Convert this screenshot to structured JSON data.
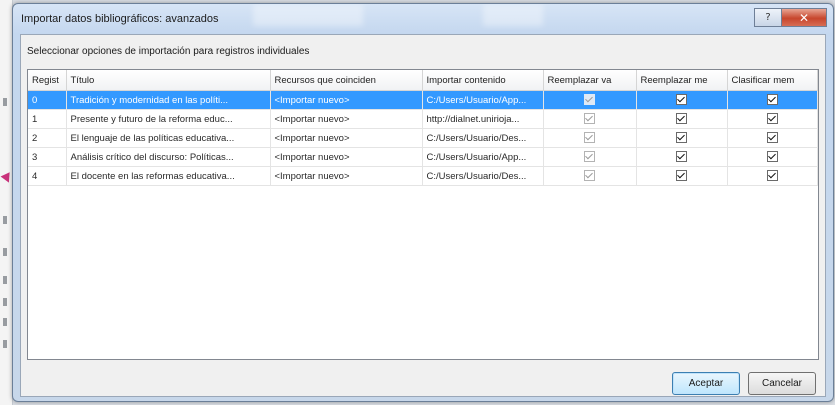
{
  "window": {
    "title": "Importar datos bibliográficos: avanzados"
  },
  "section_label": "Seleccionar opciones de importación para registros individuales",
  "table": {
    "columns": [
      "Regist",
      "Título",
      "Recursos que coinciden",
      "Importar contenido",
      "Reemplazar va",
      "Reemplazar me",
      "Clasificar mem"
    ],
    "rows": [
      {
        "regist": "0",
        "titulo": "Tradición y modernidad en las políti...",
        "recursos": "<Importar nuevo>",
        "importar": "C:/Users/Usuario/App...",
        "reemplazar_va": true,
        "reemplazar_me": true,
        "clasificar": true,
        "selected": true
      },
      {
        "regist": "1",
        "titulo": "Presente y futuro de la reforma educ...",
        "recursos": "<Importar nuevo>",
        "importar": "http://dialnet.unirioja...",
        "reemplazar_va": true,
        "reemplazar_me": true,
        "clasificar": true,
        "selected": false
      },
      {
        "regist": "2",
        "titulo": "El lenguaje de las políticas educativa...",
        "recursos": "<Importar nuevo>",
        "importar": "C:/Users/Usuario/Des...",
        "reemplazar_va": true,
        "reemplazar_me": true,
        "clasificar": true,
        "selected": false
      },
      {
        "regist": "3",
        "titulo": "Análisis crítico del discurso: Políticas...",
        "recursos": "<Importar nuevo>",
        "importar": "C:/Users/Usuario/App...",
        "reemplazar_va": true,
        "reemplazar_me": true,
        "clasificar": true,
        "selected": false
      },
      {
        "regist": "4",
        "titulo": "El docente en las reformas educativa...",
        "recursos": "<Importar nuevo>",
        "importar": "C:/Users/Usuario/Des...",
        "reemplazar_va": true,
        "reemplazar_me": true,
        "clasificar": true,
        "selected": false
      }
    ]
  },
  "buttons": {
    "accept": "Aceptar",
    "cancel": "Cancelar"
  },
  "colors": {
    "selection": "#3399ff",
    "close_button": "#c7462d",
    "titlebar": "#c4d7ef"
  }
}
